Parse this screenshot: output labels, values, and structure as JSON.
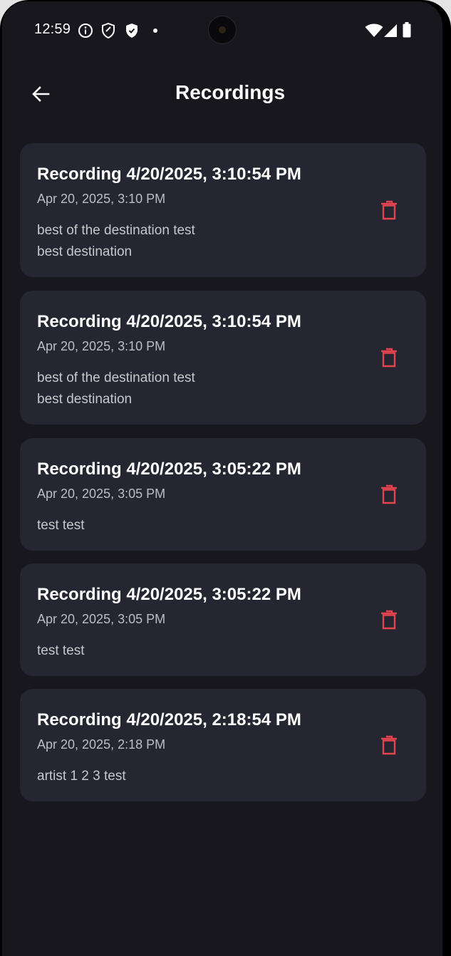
{
  "status_bar": {
    "time": "12:59",
    "icons": [
      "info-icon",
      "shield-icon",
      "shield-check-icon",
      "dot-icon",
      "wifi-icon",
      "signal-icon",
      "battery-icon"
    ]
  },
  "header": {
    "title": "Recordings",
    "back_icon": "arrow-left-icon"
  },
  "colors": {
    "background": "#17171d",
    "card": "#252631",
    "delete": "#e5434f"
  },
  "recordings": [
    {
      "title": "Recording 4/20/2025, 3:10:54 PM",
      "date": "Apr 20, 2025, 3:10 PM",
      "text": "best of the destination test\nbest destination"
    },
    {
      "title": "Recording 4/20/2025, 3:10:54 PM",
      "date": "Apr 20, 2025, 3:10 PM",
      "text": "best of the destination test\nbest destination"
    },
    {
      "title": "Recording 4/20/2025, 3:05:22 PM",
      "date": "Apr 20, 2025, 3:05 PM",
      "text": "test test"
    },
    {
      "title": "Recording 4/20/2025, 3:05:22 PM",
      "date": "Apr 20, 2025, 3:05 PM",
      "text": "test test"
    },
    {
      "title": "Recording 4/20/2025, 2:18:54 PM",
      "date": "Apr 20, 2025, 2:18 PM",
      "text": "artist 1 2 3 test"
    }
  ]
}
